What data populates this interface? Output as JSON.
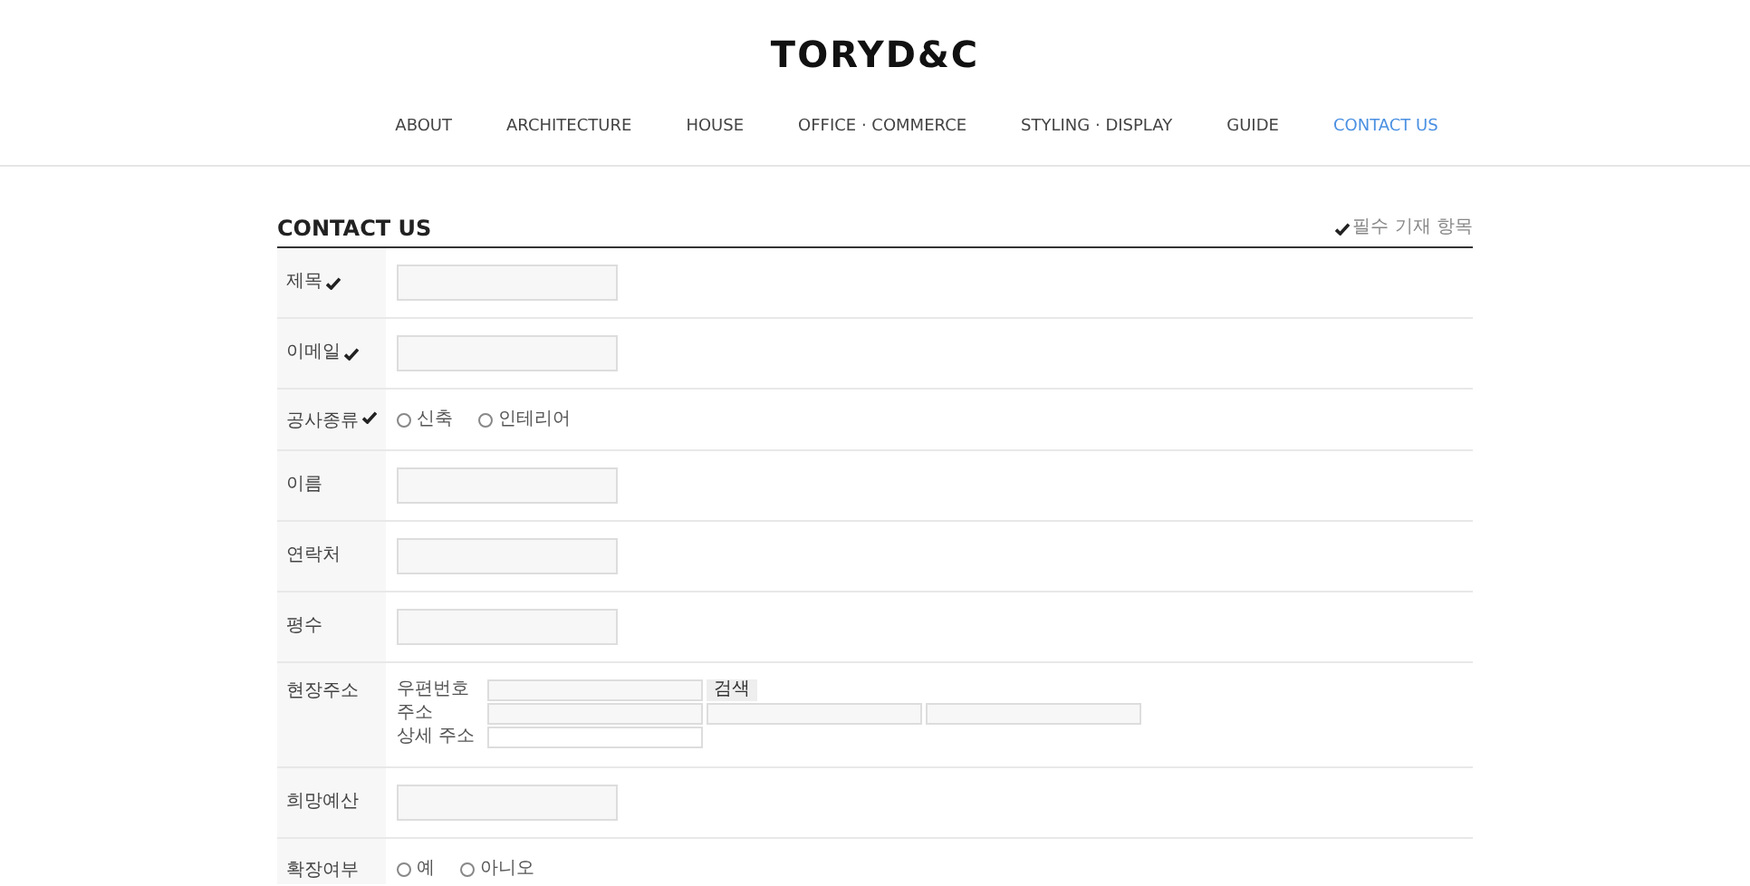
{
  "logo": "TORYD&C",
  "nav": [
    {
      "label": "ABOUT",
      "selected": false
    },
    {
      "label": "ARCHITECTURE",
      "selected": false
    },
    {
      "label": "HOUSE",
      "selected": false
    },
    {
      "label": "OFFICE · COMMERCE",
      "selected": false
    },
    {
      "label": "STYLING · DISPLAY",
      "selected": false
    },
    {
      "label": "GUIDE",
      "selected": false
    },
    {
      "label": "CONTACT US",
      "selected": true
    }
  ],
  "form": {
    "title": "CONTACT US",
    "legend": "필수 기재 항목",
    "rows": [
      {
        "kind": "text",
        "label": "제목",
        "required": true
      },
      {
        "kind": "text",
        "label": "이메일",
        "required": true
      },
      {
        "kind": "radio",
        "label": "공사종류",
        "required": true,
        "options": [
          {
            "label": "신축",
            "selected": false
          },
          {
            "label": "인테리어",
            "selected": false
          }
        ]
      },
      {
        "kind": "text",
        "label": "이름",
        "required": false
      },
      {
        "kind": "text",
        "label": "연락처",
        "required": false
      },
      {
        "kind": "text",
        "label": "평수",
        "required": false
      },
      {
        "kind": "address",
        "label": "현장주소",
        "required": false,
        "postcode_label": "우편번호",
        "search_button": "검색",
        "address_label": "주소",
        "detail_label": "상세 주소"
      },
      {
        "kind": "text",
        "label": "희망예산",
        "required": false
      },
      {
        "kind": "radio",
        "label": "확장여부",
        "required": false,
        "options": [
          {
            "label": "예",
            "selected": false
          },
          {
            "label": "아니오",
            "selected": false
          }
        ]
      }
    ]
  }
}
